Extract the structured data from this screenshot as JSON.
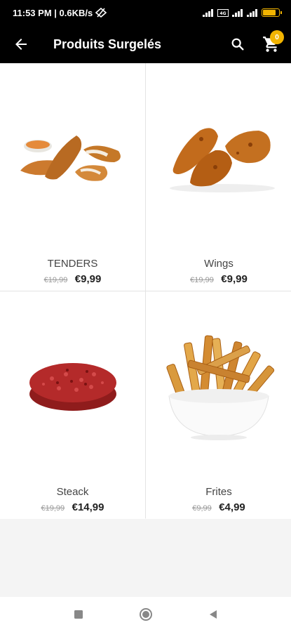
{
  "status_bar": {
    "time": "11:53 PM | 0.6KB/s",
    "battery_level": 0.8,
    "battery_color": "#f2b400"
  },
  "app_bar": {
    "title": "Produits Surgelés",
    "back_icon": "arrow-left-icon",
    "search_icon": "search-icon",
    "cart_icon": "cart-icon",
    "cart_count": "0",
    "accent_color": "#f2b400"
  },
  "products": [
    {
      "name": "TENDERS",
      "old_price": "€19,99",
      "price": "€9,99",
      "image": "chicken-tenders-image"
    },
    {
      "name": "Wings",
      "old_price": "€19,99",
      "price": "€9,99",
      "image": "chicken-wings-image"
    },
    {
      "name": "Steack",
      "old_price": "€19,99",
      "price": "€14,99",
      "image": "burger-patty-image"
    },
    {
      "name": "Frites",
      "old_price": "€9,99",
      "price": "€4,99",
      "image": "french-fries-image"
    }
  ],
  "nav": {
    "recents_icon": "square-icon",
    "home_icon": "circle-icon",
    "back_icon": "triangle-back-icon"
  }
}
